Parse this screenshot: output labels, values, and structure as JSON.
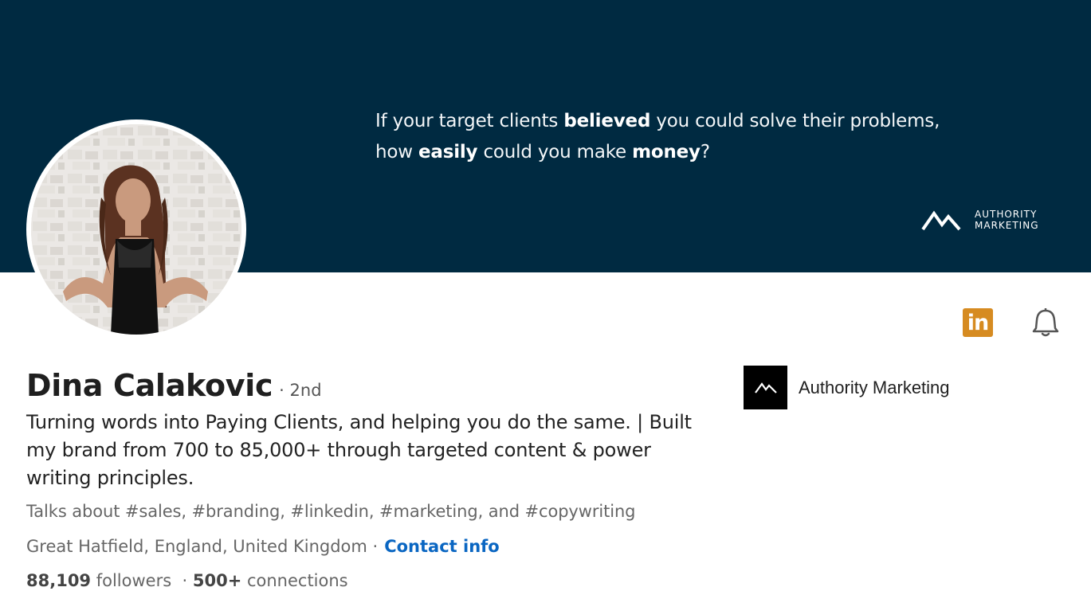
{
  "banner": {
    "quote_line1_a": "If your target clients ",
    "quote_line1_bold": "believed",
    "quote_line1_b": " you could solve their problems,",
    "quote_line2_a": "how ",
    "quote_line2_bold1": "easily",
    "quote_line2_b": " could you make ",
    "quote_line2_bold2": "money",
    "quote_line2_c": "?",
    "logo_line1": "AUTHORITY",
    "logo_line2": "MARKETING",
    "background_color": "#002a41"
  },
  "actions": {
    "linkedin_icon": "linkedin-icon",
    "bell_icon": "bell-icon",
    "linkedin_text": "in",
    "linkedin_color": "#d68b21"
  },
  "profile": {
    "name": "Dina Calakovic",
    "degree": "· 2nd",
    "headline": "Turning words into Paying Clients, and helping you do the same. | Built my brand from 700 to 85,000+ through targeted content & power writing principles.",
    "talks_about": "Talks about #sales, #branding, #linkedin, #marketing, and #copywriting",
    "location": "Great Hatfield, England, United Kingdom ·",
    "contact_label": "Contact info",
    "followers_count": "88,109",
    "followers_label": " followers",
    "separator": "  · ",
    "connections_count": "500+",
    "connections_label": " connections"
  },
  "company": {
    "name": "Authority Marketing"
  },
  "colors": {
    "link": "#0a66c2"
  }
}
